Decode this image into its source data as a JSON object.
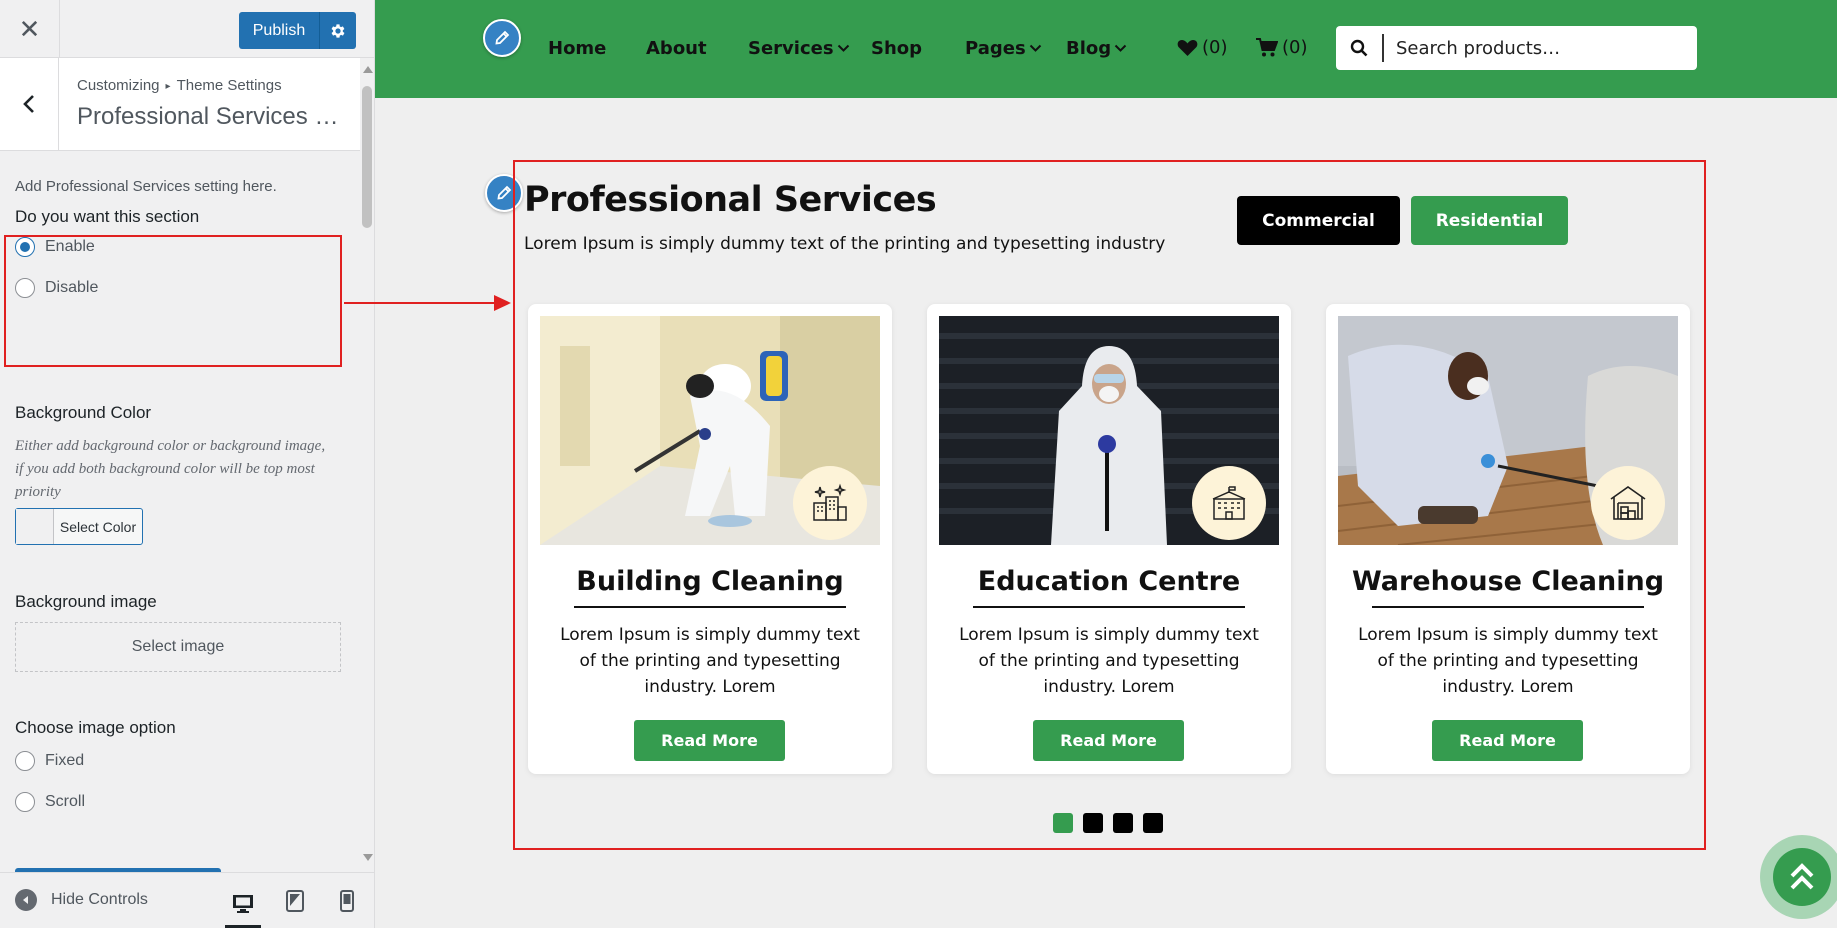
{
  "customizer": {
    "publish_label": "Publish",
    "breadcrumb": [
      "Customizing",
      "Theme Settings"
    ],
    "breadcrumb_sep": "▸",
    "section_title": "Professional Services Se...",
    "description": "Add Professional Services setting here.",
    "section_toggle": {
      "title": "Do you want this section",
      "options": [
        "Enable",
        "Disable"
      ],
      "selected": "Enable"
    },
    "background_color": {
      "title": "Background Color",
      "help": "Either add background color or background image, if you add both background color will be top most priority",
      "button_label": "Select Color"
    },
    "background_image": {
      "title": "Background image",
      "button_label": "Select image"
    },
    "image_option": {
      "title": "Choose image option",
      "options": [
        "Fixed",
        "Scroll"
      ],
      "selected": null
    },
    "footer": {
      "hide_controls": "Hide Controls",
      "devices": [
        "desktop-icon",
        "tablet-icon",
        "mobile-icon"
      ],
      "active_device": "desktop"
    }
  },
  "site": {
    "nav": {
      "items": [
        "Home",
        "About",
        "Services",
        "Shop",
        "Pages",
        "Blog"
      ],
      "wishlist_count": "(0)",
      "cart_count": "(0)",
      "search_placeholder": "Search products…"
    },
    "services": {
      "title": "Professional Services",
      "subtitle": "Lorem Ipsum is simply dummy text of the printing and typesetting industry",
      "tabs": [
        "Commercial",
        "Residential"
      ],
      "active_tab": "Residential",
      "cards": [
        {
          "title": "Building Cleaning",
          "text": "Lorem Ipsum is simply dummy text of the printing and typesetting industry. Lorem",
          "button": "Read More",
          "icon": "buildings-sparkle-icon"
        },
        {
          "title": "Education Centre",
          "text": "Lorem Ipsum is simply dummy text of the printing and typesetting industry. Lorem",
          "button": "Read More",
          "icon": "school-building-icon"
        },
        {
          "title": "Warehouse Cleaning",
          "text": "Lorem Ipsum is simply dummy text of the printing and typesetting industry. Lorem",
          "button": "Read More",
          "icon": "warehouse-icon"
        }
      ],
      "slider_dots": 4,
      "active_dot": 1
    }
  },
  "colors": {
    "brand_green": "#359c4f",
    "wp_blue": "#2271b1",
    "annotation_red": "#e02020"
  }
}
